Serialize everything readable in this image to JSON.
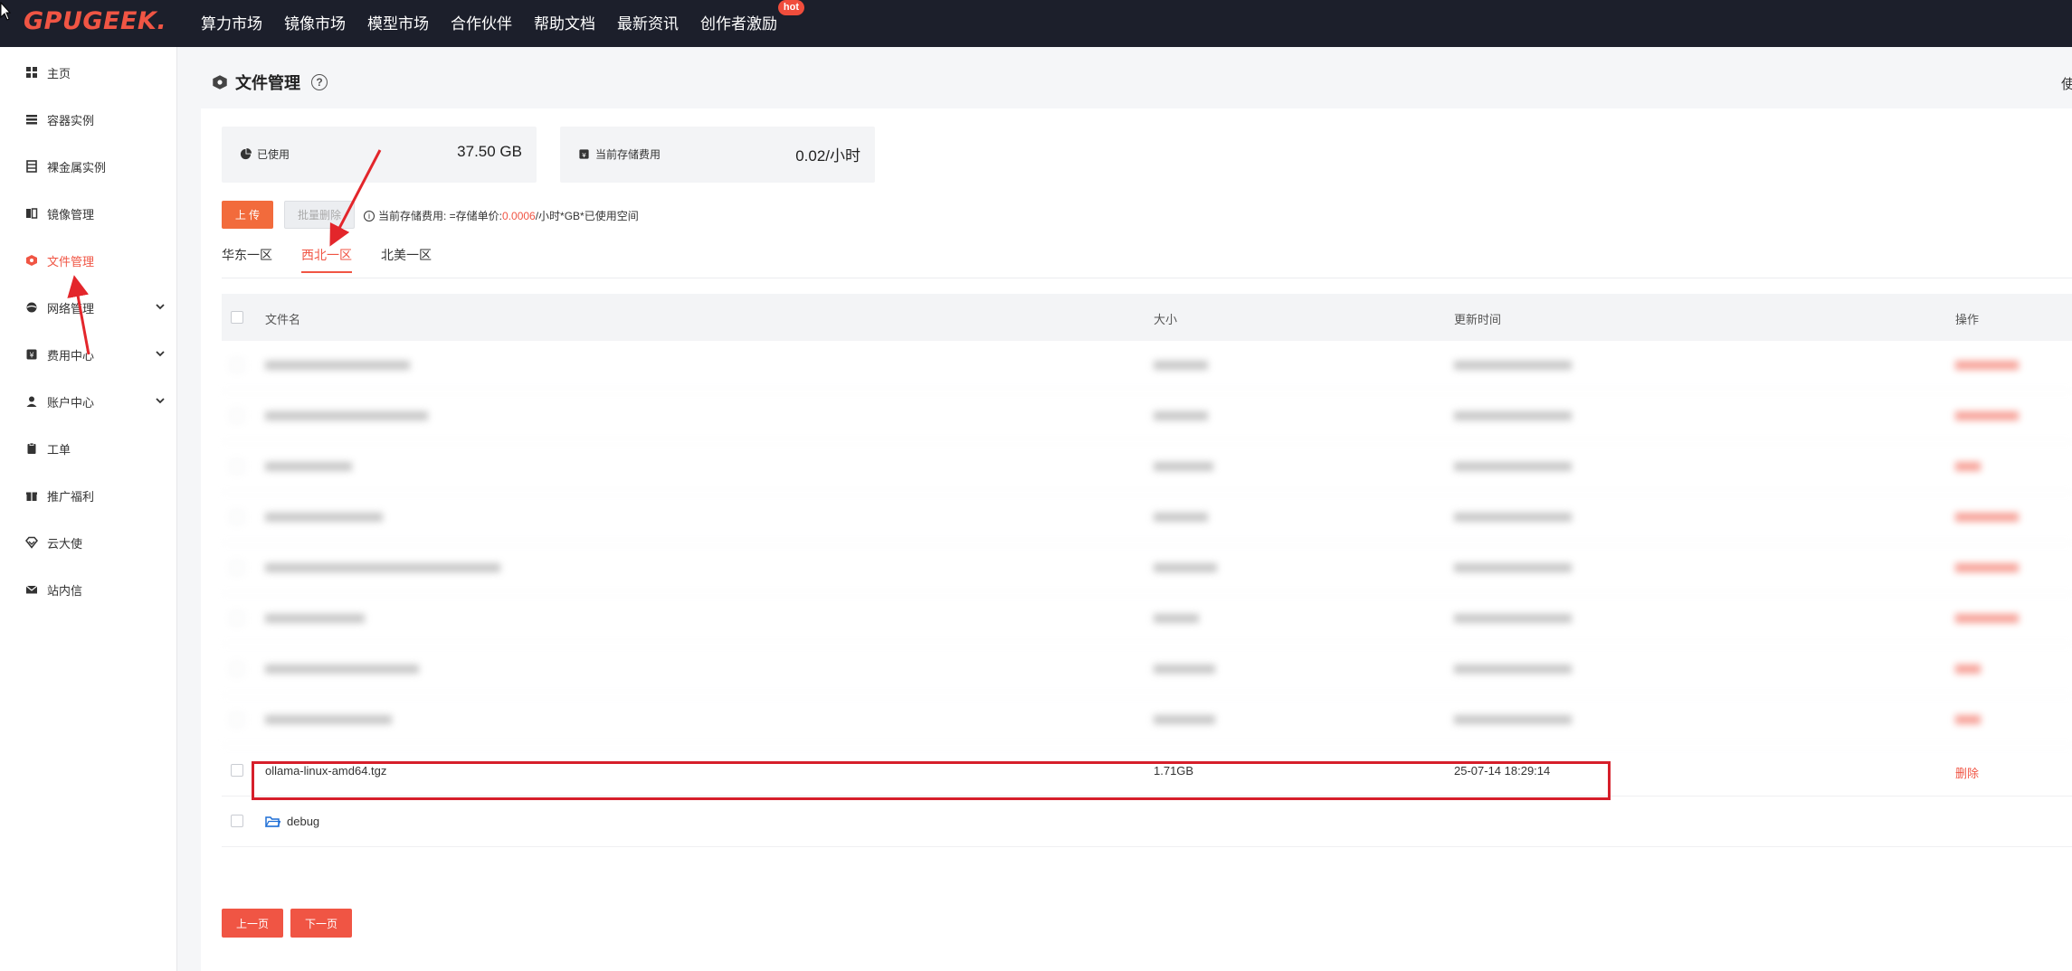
{
  "brand": {
    "logo_text": "GPUGEEK",
    "logo_dot": "."
  },
  "topnav": {
    "items": [
      "算力市场",
      "镜像市场",
      "模型市场",
      "合作伙伴",
      "帮助文档",
      "最新资讯",
      "创作者激励"
    ],
    "hot_badge": "hot"
  },
  "sidebar": {
    "items": [
      {
        "label": "主页",
        "icon": "grid-icon"
      },
      {
        "label": "容器实例",
        "icon": "list-icon"
      },
      {
        "label": "裸金属实例",
        "icon": "server-icon"
      },
      {
        "label": "镜像管理",
        "icon": "image-icon"
      },
      {
        "label": "文件管理",
        "icon": "file-icon",
        "active": true
      },
      {
        "label": "网络管理",
        "icon": "network-icon",
        "expandable": true
      },
      {
        "label": "费用中心",
        "icon": "wallet-icon",
        "expandable": true
      },
      {
        "label": "账户中心",
        "icon": "user-icon",
        "expandable": true
      },
      {
        "label": "工单",
        "icon": "clipboard-icon"
      },
      {
        "label": "推广福利",
        "icon": "gift-icon"
      },
      {
        "label": "云大使",
        "icon": "diamond-icon"
      },
      {
        "label": "站内信",
        "icon": "mail-icon"
      }
    ]
  },
  "page": {
    "title": "文件管理",
    "help": "?",
    "cut_text": "使"
  },
  "stats": {
    "used_label": "已使用",
    "used_value": "37.50 GB",
    "cost_label": "当前存储费用",
    "cost_value": "0.02/小时"
  },
  "actions": {
    "upload": "上 传",
    "batch_delete": "批量删除",
    "hint_prefix": "当前存储费用: =存储单价: ",
    "hint_price": "0.0006",
    "hint_suffix": "/小时*GB*已使用空间"
  },
  "tabs": [
    "华东一区",
    "西北一区",
    "北美一区"
  ],
  "active_tab": 1,
  "table": {
    "headers": {
      "name": "文件名",
      "size": "大小",
      "time": "更新时间",
      "ops": "操作"
    },
    "visible_rows": [
      {
        "name": "ollama-linux-amd64.tgz",
        "size": "1.71GB",
        "time": "25-07-14 18:29:14",
        "op": "删除"
      },
      {
        "name": "debug",
        "folder": true
      }
    ]
  },
  "pagination": {
    "prev": "上一页",
    "next": "下一页"
  },
  "colors": {
    "accent": "#f05544",
    "topbar": "#1c1f2b",
    "highlight": "#d61f2b",
    "folder": "#1f6fd6"
  }
}
